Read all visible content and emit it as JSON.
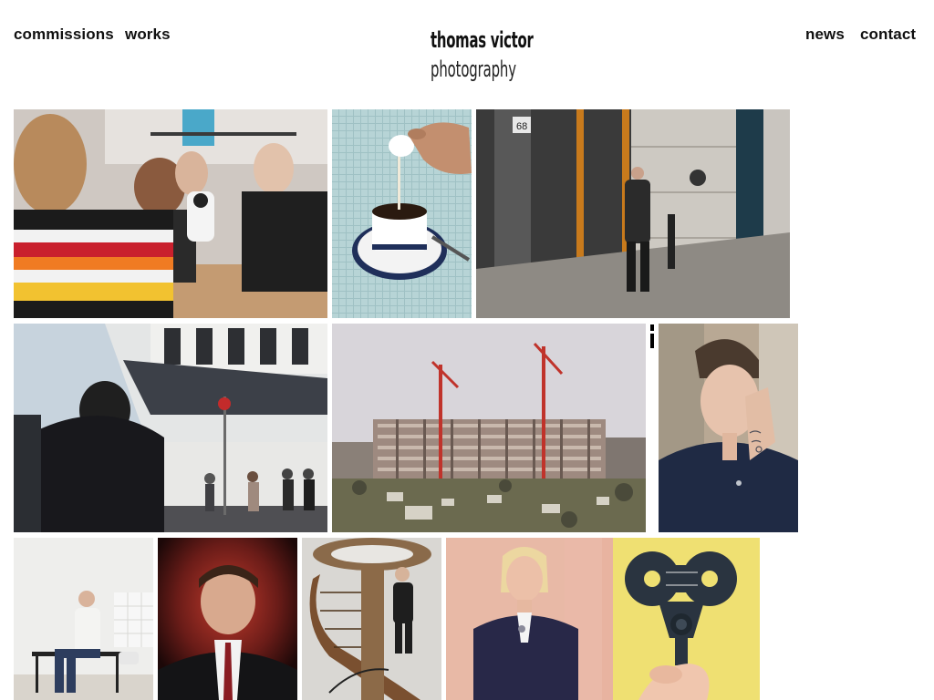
{
  "nav": {
    "left": [
      {
        "label": "commissions"
      },
      {
        "label": "works"
      }
    ],
    "right": [
      {
        "label": "news"
      },
      {
        "label": "contact"
      }
    ]
  },
  "logo": {
    "line1": "thomas victor",
    "line2": "photography"
  },
  "gallery": {
    "rows": [
      {
        "photos": [
          "classroom-students-robot",
          "cream-pour-coffee-cup",
          "man-doorway-building-68"
        ]
      },
      {
        "photos": [
          "street-corner-pedestrians",
          "construction-cranes-housing",
          "portrait-hand-face-tattoo"
        ]
      },
      {
        "photos": [
          "man-seated-white-room",
          "portrait-man-red-backdrop",
          "man-spiral-staircase",
          "woman-pink-wall",
          "hand-holding-camera-yellow"
        ]
      }
    ],
    "door_number": "68"
  },
  "colors": {
    "background": "#ffffff",
    "text": "#111111"
  }
}
